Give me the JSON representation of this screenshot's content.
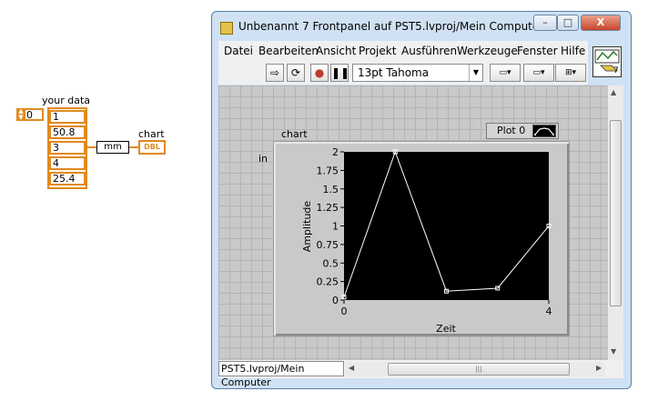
{
  "block_diagram": {
    "array_label": "your data",
    "index_value": "0",
    "array_values": [
      "1",
      "50.8",
      "3",
      "4",
      "25.4"
    ],
    "unit_node": "mm",
    "indicator_label": "chart",
    "indicator_type": "DBL",
    "unit_label": "in"
  },
  "window": {
    "title": "Unbenannt 7 Frontpanel auf PST5.lvproj/Mein Computer *",
    "controls": {
      "minimize": "–",
      "maximize": "□",
      "close": "X"
    }
  },
  "menu": [
    "Datei",
    "Bearbeiten",
    "Ansicht",
    "Projekt",
    "Ausführen",
    "Werkzeuge",
    "Fenster",
    "Hilfe"
  ],
  "toolbar": {
    "font": "13pt Tahoma",
    "vi_icon_number": "7"
  },
  "status": {
    "context": "PST5.lvproj/Mein Computer"
  },
  "colors": {
    "accent_orange": "#e08a1e",
    "plot_bg": "#000000",
    "plot_line": "#ffffff"
  },
  "chart_data": {
    "type": "line",
    "title": "chart",
    "xlabel": "Zeit",
    "ylabel": "Amplitude",
    "legend": "Plot 0",
    "x": [
      0,
      1,
      2,
      3,
      4
    ],
    "series": [
      {
        "name": "Plot 0",
        "values": [
          0.04,
          2,
          0.12,
          0.16,
          1
        ]
      }
    ],
    "xlim": [
      0,
      4
    ],
    "ylim": [
      0,
      2
    ],
    "x_ticks": [
      "0",
      "4"
    ],
    "y_ticks": [
      "0",
      "0.25",
      "0.5",
      "0.75",
      "1",
      "1.25",
      "1.5",
      "1.75",
      "2"
    ]
  }
}
